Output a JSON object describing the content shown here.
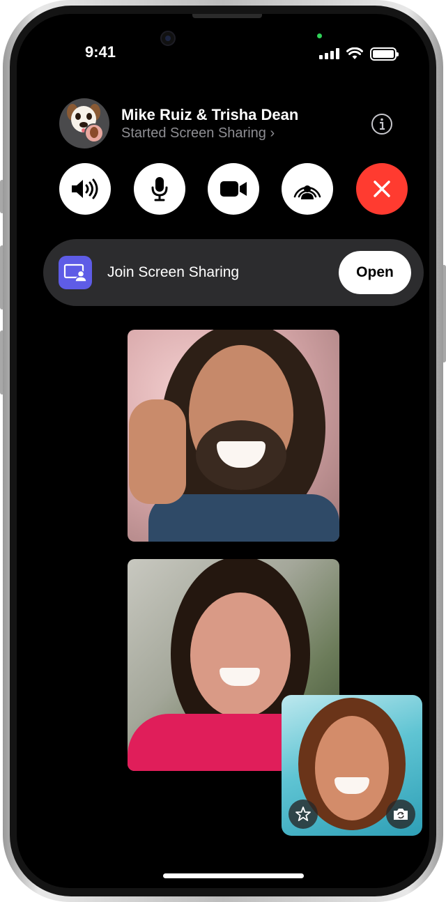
{
  "status_bar": {
    "time": "9:41"
  },
  "call_header": {
    "names": "Mike Ruiz &  Trisha Dean",
    "status": "Started Screen Sharing ›"
  },
  "controls": {
    "speaker_icon": "speaker-wave-icon",
    "mic_icon": "microphone-icon",
    "camera_icon": "video-camera-icon",
    "shareplay_icon": "shareplay-icon",
    "end_icon": "close-x-icon",
    "end_color": "#ff3b30"
  },
  "banner": {
    "label": "Join Screen Sharing",
    "open_label": "Open",
    "app_icon_color": "#5e5ce6"
  },
  "self_view": {
    "effects_icon": "effects-star-icon",
    "flip_icon": "camera-flip-icon"
  }
}
